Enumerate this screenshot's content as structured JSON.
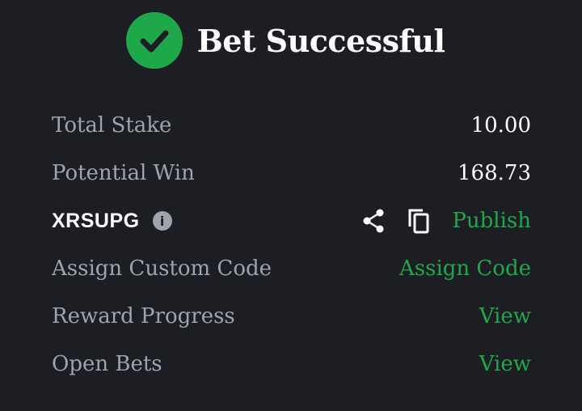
{
  "header": {
    "title": "Bet Successful"
  },
  "rows": {
    "total_stake": {
      "label": "Total Stake",
      "value": "10.00"
    },
    "potential_win": {
      "label": "Potential Win",
      "value": "168.73"
    },
    "booking": {
      "code": "XRSUPG",
      "action": "Publish"
    },
    "custom_code": {
      "label": "Assign Custom Code",
      "action": "Assign Code"
    },
    "reward": {
      "label": "Reward Progress",
      "action": "View"
    },
    "open_bets": {
      "label": "Open Bets",
      "action": "View"
    }
  },
  "colors": {
    "background": "#1c1e24",
    "accent_green": "#1fa84a",
    "muted_text": "#9ea3ad",
    "text": "#ffffff"
  },
  "icons": [
    "check-icon",
    "info-icon",
    "share-icon",
    "copy-icon"
  ]
}
